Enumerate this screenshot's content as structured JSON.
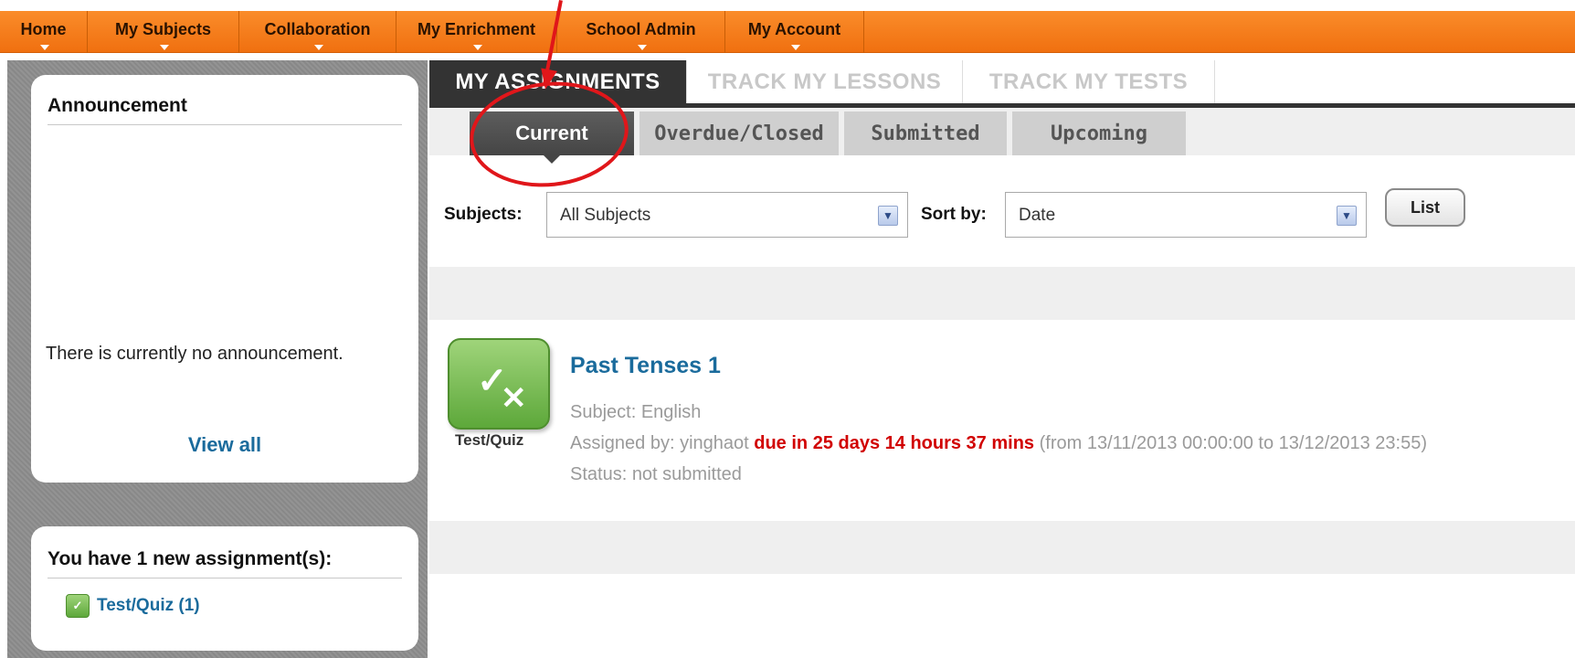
{
  "nav": {
    "items": [
      {
        "label": "Home"
      },
      {
        "label": "My Subjects"
      },
      {
        "label": "Collaboration"
      },
      {
        "label": "My Enrichment"
      },
      {
        "label": "School Admin"
      },
      {
        "label": "My Account"
      }
    ]
  },
  "announcement": {
    "title": "Announcement",
    "message": "There is currently no announcement.",
    "view_all": "View all"
  },
  "new_assignments": {
    "title": "You have 1 new assignment(s):",
    "link": "Test/Quiz (1)",
    "icon": "test-quiz-icon"
  },
  "main_tabs": [
    {
      "label": "MY ASSIGNMENTS",
      "active": true
    },
    {
      "label": "TRACK MY LESSONS",
      "active": false
    },
    {
      "label": "TRACK MY TESTS",
      "active": false
    }
  ],
  "sub_tabs": [
    {
      "label": "Current",
      "active": true
    },
    {
      "label": "Overdue/Closed",
      "active": false
    },
    {
      "label": "Submitted",
      "active": false
    },
    {
      "label": "Upcoming",
      "active": false
    }
  ],
  "filters": {
    "subjects_label": "Subjects:",
    "subjects_value": "All Subjects",
    "sort_label": "Sort by:",
    "sort_value": "Date",
    "list_button": "List"
  },
  "assignment": {
    "type_label": "Test/Quiz",
    "title": "Past Tenses 1",
    "subject": "Subject: English",
    "assigned_by": "Assigned by: yinghaot",
    "due": "due in 25 days 14 hours 37 mins",
    "period": "(from 13/11/2013 00:00:00 to 13/12/2013 23:55)",
    "status": "Status: not submitted"
  },
  "colors": {
    "nav_orange": "#f07010",
    "link_blue": "#1a6b9c",
    "due_red": "#d10000",
    "annotation_red": "#e0161a"
  }
}
